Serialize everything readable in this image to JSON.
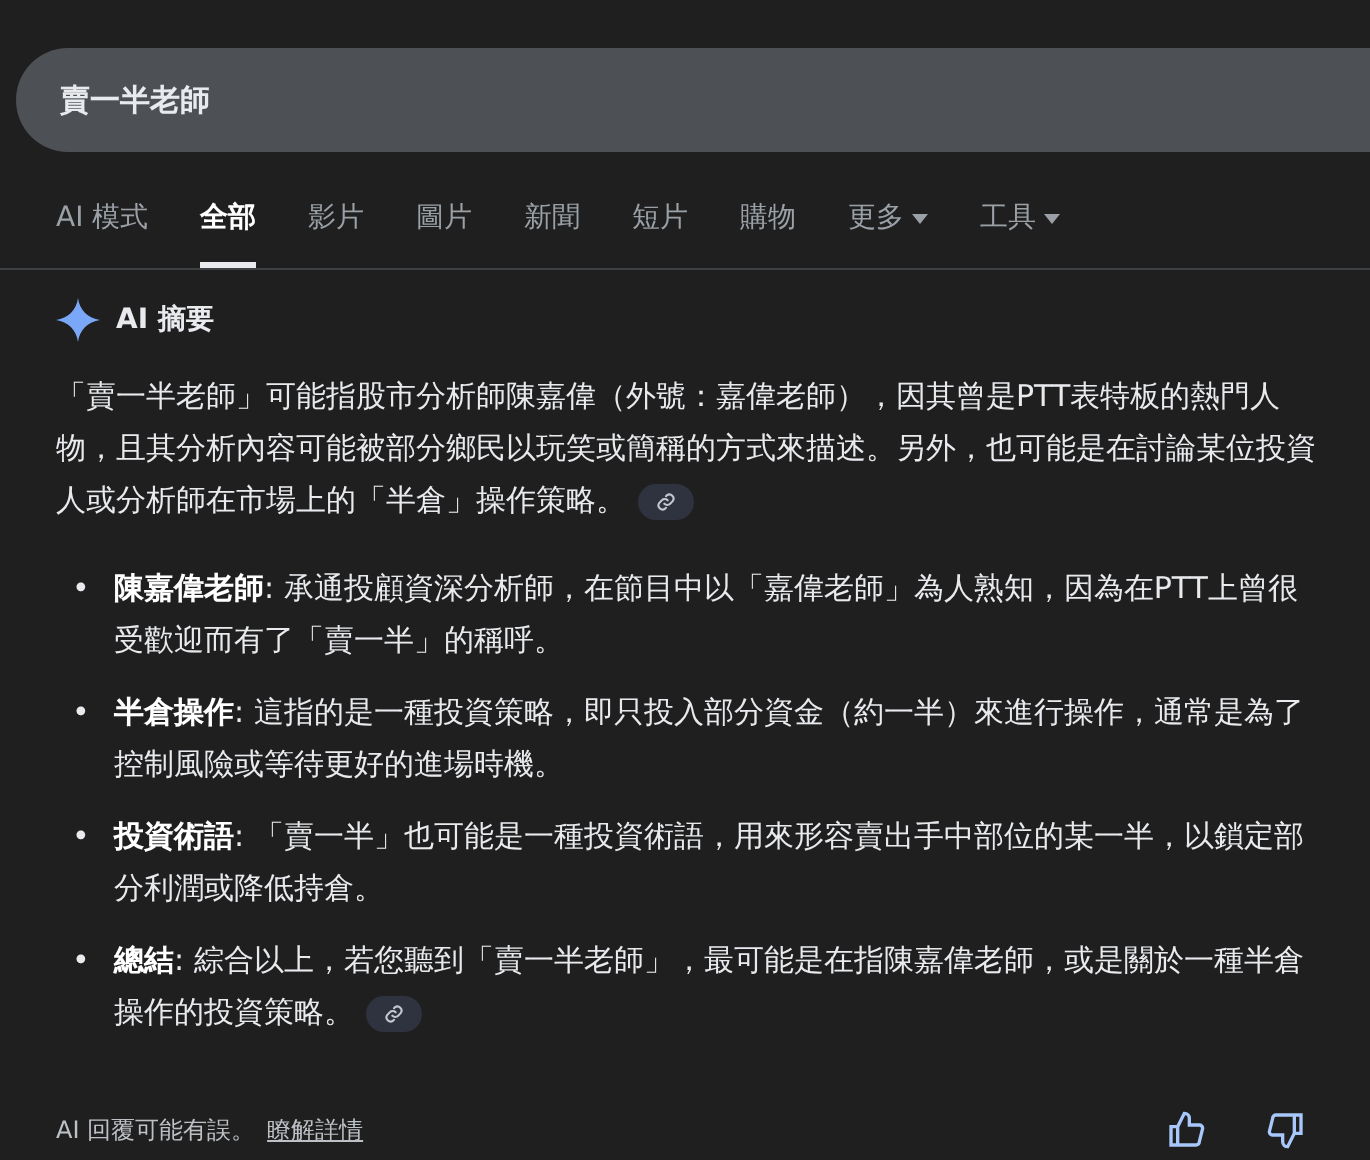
{
  "search": {
    "value": "賣一半老師"
  },
  "tabs": [
    {
      "label": "AI 模式",
      "selected": false,
      "dropdown": false
    },
    {
      "label": "全部",
      "selected": true,
      "dropdown": false
    },
    {
      "label": "影片",
      "selected": false,
      "dropdown": false
    },
    {
      "label": "圖片",
      "selected": false,
      "dropdown": false
    },
    {
      "label": "新聞",
      "selected": false,
      "dropdown": false
    },
    {
      "label": "短片",
      "selected": false,
      "dropdown": false
    },
    {
      "label": "購物",
      "selected": false,
      "dropdown": false
    },
    {
      "label": "更多",
      "selected": false,
      "dropdown": true
    },
    {
      "label": "工具",
      "selected": false,
      "dropdown": true
    }
  ],
  "overview": {
    "title": "AI 摘要",
    "paragraph": "「賣一半老師」可能指股市分析師陳嘉偉（外號：嘉偉老師），因其曾是PTT表特板的熱門人物，且其分析內容可能被部分鄉民以玩笑或簡稱的方式來描述。另外，也可能是在討論某位投資人或分析師在市場上的「半倉」操作策略。",
    "paragraph_has_link": true,
    "bullets": [
      {
        "bullet": "•",
        "text": "**陳嘉偉老師**: 承通投顧資深分析師，在節目中以「嘉偉老師」為人熟知，因為在PTT上曾很受歡迎而有了「賣一半」的稱呼。",
        "has_link": false
      },
      {
        "bullet": "•",
        "text": "**半倉操作**: 這指的是一種投資策略，即只投入部分資金（約一半）來進行操作，通常是為了控制風險或等待更好的進場時機。",
        "has_link": false
      },
      {
        "bullet": "•",
        "text": "**投資術語**: 「賣一半」也可能是一種投資術語，用來形容賣出手中部位的某一半，以鎖定部分利潤或降低持倉。",
        "has_link": false
      },
      {
        "bullet": "•",
        "text": "**總結**: 綜合以上，若您聽到「賣一半老師」，最可能是在指陳嘉偉老師，或是關於一種半倉操作的投資策略。",
        "has_link": true
      }
    ]
  },
  "footer": {
    "disclaimer": "AI 回覆可能有誤。",
    "learn_more": "瞭解詳情"
  }
}
